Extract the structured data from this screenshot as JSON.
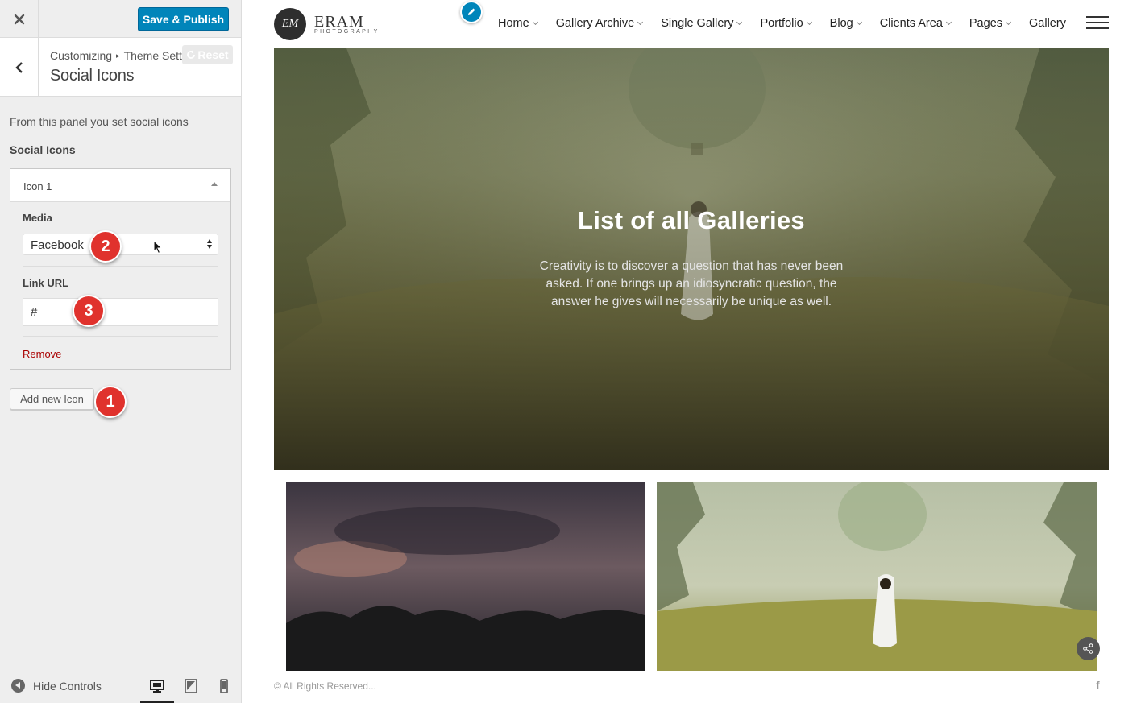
{
  "customizer": {
    "close_icon": "close-icon",
    "save_label": "Save & Publish",
    "breadcrumb": {
      "root": "Customizing",
      "separator": "▸",
      "parent": "Theme Settings"
    },
    "section_title": "Social Icons",
    "reset_label": "Reset",
    "panel_description": "From this panel you set social icons",
    "panel_heading": "Social Icons",
    "repeater_item": {
      "title": "Icon 1",
      "media_label": "Media",
      "media_value": "Facebook",
      "link_label": "Link URL",
      "link_value": "#",
      "remove_label": "Remove"
    },
    "add_button_label": "Add new Icon",
    "annotations": [
      "1",
      "2",
      "3"
    ],
    "footer": {
      "hide_controls_label": "Hide Controls",
      "devices": [
        "desktop-icon",
        "tablet-icon",
        "mobile-icon"
      ],
      "active_device": "desktop"
    },
    "colors": {
      "primary": "#0085ba",
      "badge": "#e0322d",
      "remove": "#aa0000"
    }
  },
  "site": {
    "logo": {
      "monogram": "EM",
      "name": "ERAM",
      "tagline": "PHOTOGRAPHY"
    },
    "nav": [
      "Home",
      "Gallery Archive",
      "Single Gallery",
      "Portfolio",
      "Blog",
      "Clients Area",
      "Pages",
      "Gallery"
    ],
    "hero": {
      "title": "List of all Galleries",
      "text": "Creativity is to discover a question that has never been asked. If one brings up an idiosyncratic question, the answer he gives will necessarily be unique as well."
    },
    "footer": {
      "copyright": "© All Rights Reserved...",
      "social_icon": "f"
    }
  }
}
